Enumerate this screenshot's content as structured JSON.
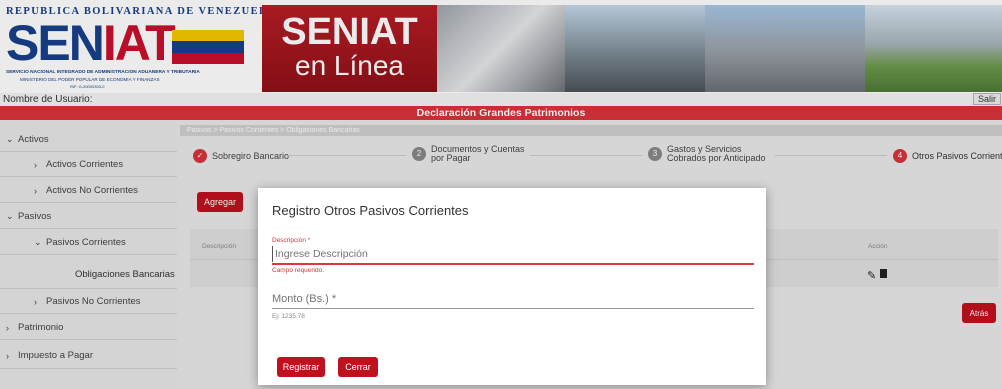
{
  "banner": {
    "republic": "REPUBLICA BOLIVARIANA DE VENEZUELA",
    "logo_a": "SEN",
    "logo_b": "IAT",
    "agency": "SERVICIO NACIONAL INTEGRADO DE ADMINISTRACION ADUANERA Y TRIBUTARIA",
    "ministry": "MINISTERIO DEL PODER POPULAR DE ECONOMIA Y FINANZAS",
    "rif": "RIF: G-20000303-0",
    "title_1": "SENIAT",
    "title_2": "en Línea"
  },
  "userbar": {
    "label": "Nombre de Usuario:",
    "logout": "Salir"
  },
  "page": {
    "title": "Declaración Grandes Patrimonios"
  },
  "breadcrumb": "Pasivos > Pasivos Corrientes > Obligaciones Bancarias",
  "sidebar": {
    "activos": "Activos",
    "activos_corrientes": "Activos Corrientes",
    "activos_no_corrientes": "Activos No Corrientes",
    "pasivos": "Pasivos",
    "pasivos_corrientes": "Pasivos Corrientes",
    "obligaciones": "Obligaciones Bancarias",
    "pasivos_no_corrientes": "Pasivos No Corrientes",
    "patrimonio": "Patrimonio",
    "impuesto": "Impuesto a Pagar"
  },
  "steps": [
    {
      "num": "✓",
      "label": "Sobregiro Bancario"
    },
    {
      "num": "2",
      "label_1": "Documentos y Cuentas",
      "label_2": "por Pagar"
    },
    {
      "num": "3",
      "label_1": "Gastos y Servicios",
      "label_2": "Cobrados por Anticipado"
    },
    {
      "num": "4",
      "label": "Otros Pasivos Corrientes"
    }
  ],
  "buttons": {
    "add": "Agregar",
    "back": "Atrás"
  },
  "table": {
    "col_desc": "Descripción",
    "col_action": "Acción"
  },
  "modal": {
    "title": "Registro Otros Pasivos Corrientes",
    "desc_label": "Descripción *",
    "desc_placeholder": "Ingrese Descripción",
    "desc_error": "Campo requerido.",
    "amount_label": "Monto (Bs.) *",
    "amount_hint": "Ej: 1235.78",
    "submit": "Registrar",
    "close": "Cerrar"
  },
  "colors": {
    "accent": "#c0111e",
    "header_red": "#d7343b",
    "brand_blue": "#173f8a"
  }
}
